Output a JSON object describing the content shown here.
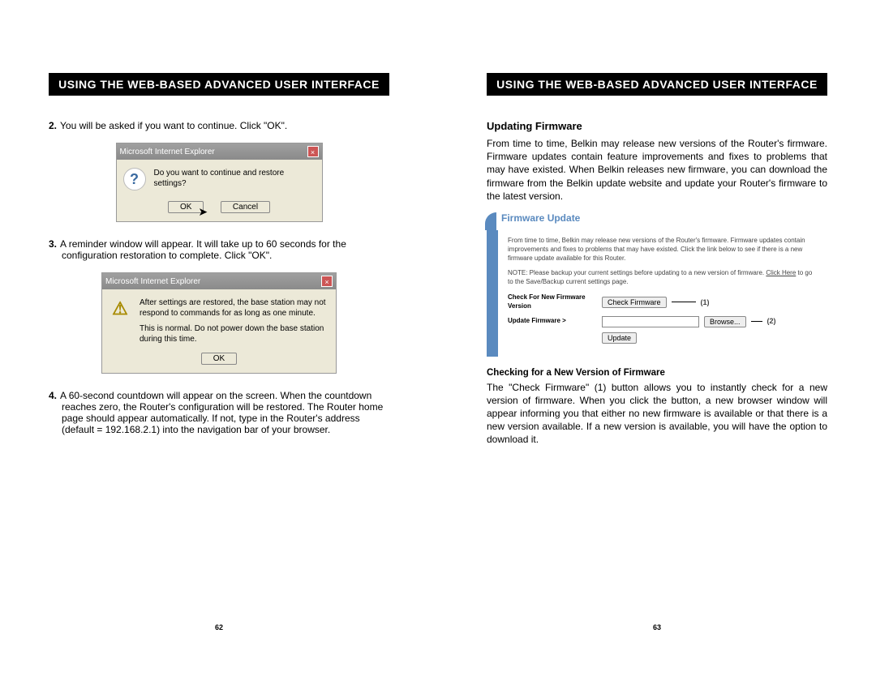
{
  "header": "USING THE WEB-BASED ADVANCED USER INTERFACE",
  "left": {
    "step2": {
      "num": "2.",
      "text": "You will be asked if you want to continue. Click \"OK\"."
    },
    "dialog1": {
      "title": "Microsoft Internet Explorer",
      "msg": "Do you want to continue and restore settings?",
      "ok": "OK",
      "cancel": "Cancel"
    },
    "step3": {
      "num": "3.",
      "text": "A reminder window will appear. It will take up to 60 seconds for the configuration restoration to complete. Click \"OK\"."
    },
    "dialog2": {
      "title": "Microsoft Internet Explorer",
      "msg1": "After settings are restored, the base station may not respond to commands for as long as one minute.",
      "msg2": "This is normal. Do not power down the base station during this time.",
      "ok": "OK"
    },
    "step4": {
      "num": "4.",
      "text": "A 60-second countdown will appear on the screen. When the countdown reaches zero, the Router's configuration will be restored. The Router home page should appear automatically. If not, type in the Router's address (default = 192.168.2.1) into the navigation bar of your browser."
    },
    "pageNumber": "62"
  },
  "right": {
    "updating_title": "Updating Firmware",
    "updating_body": "From time to time, Belkin may release new versions of the Router's firmware. Firmware updates contain feature improvements and fixes to problems that may have existed. When Belkin releases new firmware, you can download the firmware from the Belkin update website and update your Router's firmware to the latest version.",
    "panel": {
      "title": "Firmware Update",
      "intro": "From time to time, Belkin may release new versions of the Router's firmware. Firmware updates contain improvements and fixes to problems that may have existed. Click the link below to see if there is a new firmware update available for this Router.",
      "note_prefix": "NOTE: Please backup your current settings before updating to a new version of firmware. ",
      "note_link": "Click Here",
      "note_suffix": " to go to the Save/Backup current settings page.",
      "check_label": "Check For New Firmware Version",
      "check_btn": "Check Firmware",
      "annot1": "(1)",
      "update_label": "Update Firmware >",
      "browse_btn": "Browse...",
      "annot2": "(2)",
      "update_btn": "Update"
    },
    "checking_title": "Checking for a New Version of Firmware",
    "checking_body": "The \"Check Firmware\" (1) button allows you to instantly check for a new version of firmware. When you click the button, a new browser window will appear informing you that either no new firmware is available or that there is a new version available. If a new version is available, you will have the option to download it.",
    "pageNumber": "63"
  }
}
